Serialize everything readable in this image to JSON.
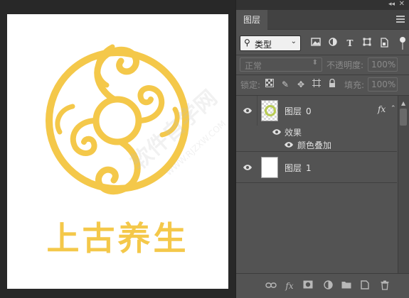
{
  "canvas": {
    "logo_text": "上古养生",
    "logo_color": "#f4c84a"
  },
  "panel": {
    "tab_label": "图层",
    "icons": {
      "collapse": "double-chevron-left-icon",
      "close": "close-icon",
      "menu": "hamburger-menu-icon"
    },
    "filter": {
      "kind_label": "类型",
      "icons": [
        "image-filter-icon",
        "adjustment-filter-icon",
        "type-filter-icon",
        "shape-filter-icon",
        "smart-object-filter-icon"
      ]
    },
    "blend_mode": "正常",
    "opacity_label": "不透明度:",
    "opacity_value": "100%",
    "lock_label": "锁定:",
    "fill_label": "填充:",
    "fill_value": "100%",
    "layers": [
      {
        "name": "图层",
        "index": "0",
        "fx": "fx",
        "effects_label": "效果",
        "effect_items": [
          "颜色叠加"
        ]
      },
      {
        "name": "图层",
        "index": "1"
      }
    ],
    "bottom_icons": [
      "link-layers-icon",
      "fx-icon",
      "mask-icon",
      "adjustment-icon",
      "folder-icon",
      "new-layer-icon",
      "trash-icon"
    ]
  },
  "watermark": {
    "main": "软件自学网",
    "sub": "WWW.RJZXW.COM"
  },
  "colors": {
    "panel_bg": "#535353",
    "app_bg": "#282828",
    "thumb_accent": "#b9cc53"
  }
}
